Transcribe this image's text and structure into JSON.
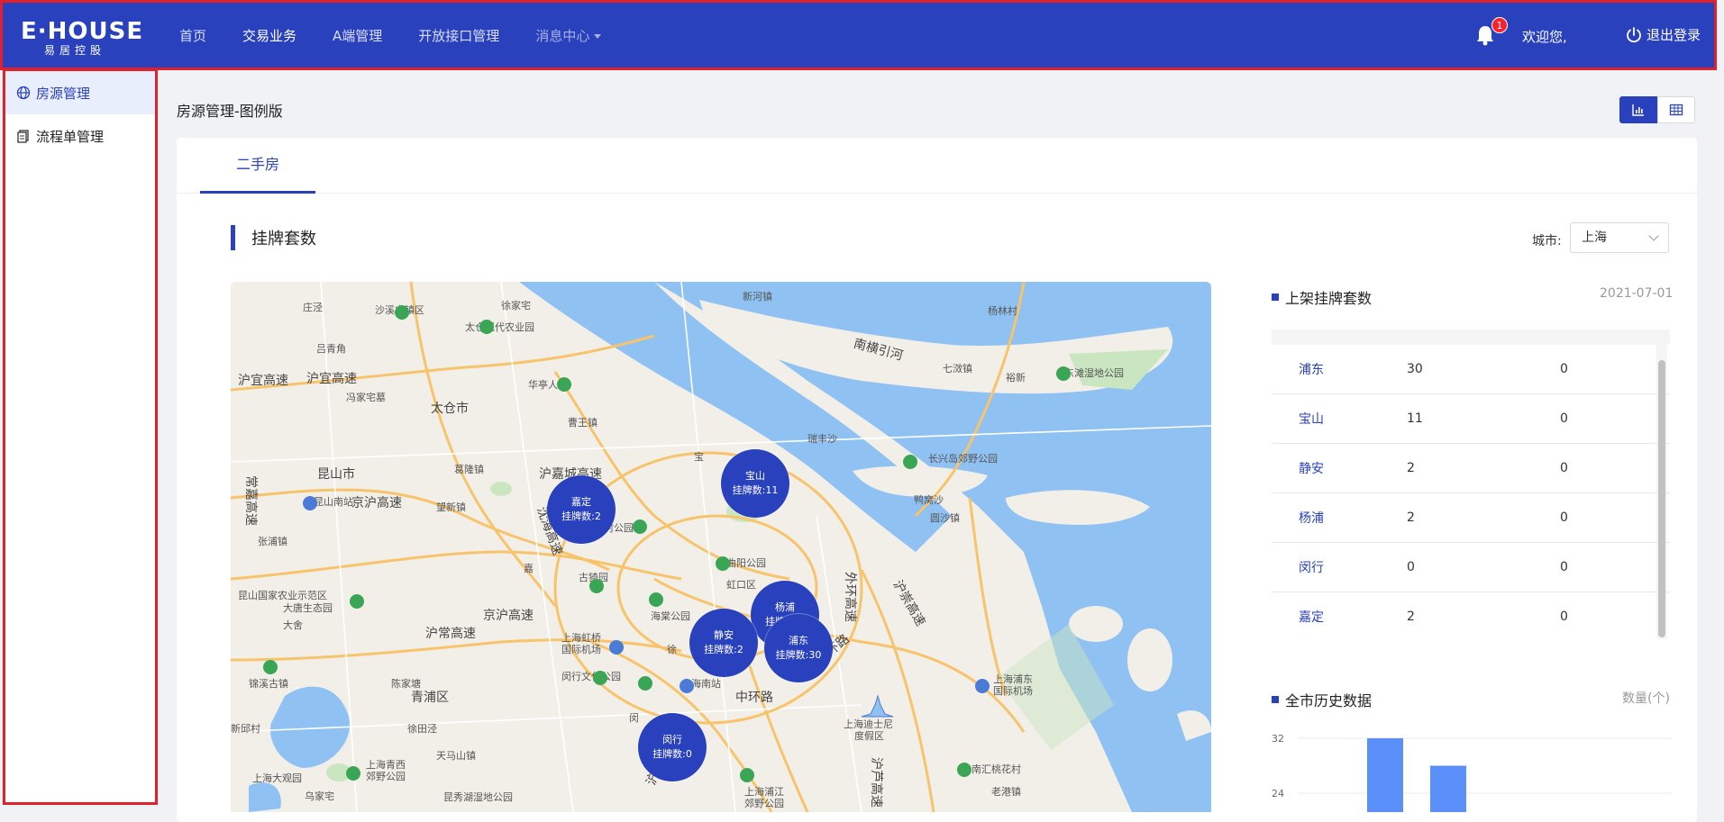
{
  "header": {
    "logo_main": "E·HOUSE",
    "logo_sub": "易居控股",
    "nav": [
      {
        "label": "首页"
      },
      {
        "label": "交易业务"
      },
      {
        "label": "A端管理"
      },
      {
        "label": "开放接口管理"
      },
      {
        "label": "消息中心"
      }
    ],
    "notification_count": "1",
    "welcome": "欢迎您,",
    "logout": "退出登录"
  },
  "sidebar": {
    "items": [
      {
        "label": "房源管理",
        "icon": "globe-icon"
      },
      {
        "label": "流程单管理",
        "icon": "document-icon"
      }
    ]
  },
  "main": {
    "page_title": "房源管理-图例版",
    "tabs": [
      {
        "label": "二手房"
      }
    ],
    "section_title": "挂牌套数",
    "city_label": "城市:",
    "city_value": "上海"
  },
  "map": {
    "clusters": [
      {
        "name": "嘉定",
        "count_label": "挂牌数:2"
      },
      {
        "name": "宝山",
        "count_label": "挂牌数:11"
      },
      {
        "name": "杨浦",
        "count_label": "挂牌数:2"
      },
      {
        "name": "静安",
        "count_label": "挂牌数:2"
      },
      {
        "name": "浦东",
        "count_label": "挂牌数:30"
      },
      {
        "name": "闵行",
        "count_label": "挂牌数:0"
      }
    ],
    "labels": [
      "庄泾",
      "沙溪古镇区",
      "徐家宅",
      "新河镇",
      "杨林村",
      "太仓现代农业园",
      "吕青角",
      "南横引河",
      "七滧镇",
      "东滩湿地公园",
      "裕新",
      "沪宜高速",
      "沪宜高速",
      "华亭人家",
      "冯家宅墓",
      "太仓市",
      "曹王镇",
      "瑞丰沙",
      "长兴岛郊野公园",
      "常嘉高速",
      "昆山市",
      "葛隆镇",
      "嘉",
      "沪嘉城高速",
      "宝",
      "鸭窝沙",
      "昆山南站",
      "望新镇",
      "顾村公园",
      "圆沙镇",
      "京沪高速",
      "沈海高速",
      "曲阳公园",
      "外环高速",
      "沪崇高速",
      "张浦镇",
      "古猗园",
      "虹口区",
      "昆山国家农业示范区",
      "大唐生态园",
      "京沪高速",
      "海棠公园",
      "大舍",
      "沪常高速",
      "上海虹桥国际机场",
      "徐",
      "中环路",
      "上海浦东国际机场",
      "锦溪古镇",
      "陈家塘",
      "青浦区",
      "闵行文化公园",
      "上海南站",
      "上海迪士尼度假区",
      "新邱村",
      "徐田泾",
      "天马山镇",
      "闵",
      "上海大观园",
      "上海青西郊野公园",
      "上海浦江郊野公园",
      "南汇桃花村",
      "老港镇",
      "乌家宅",
      "昆秀湖湿地公园",
      "沪芦高速",
      "沪",
      "外环路"
    ]
  },
  "right_panel": {
    "listing_title": "上架挂牌套数",
    "listing_date": "2021-07-01",
    "rows": [
      {
        "name": "浦东",
        "v1": "30",
        "v2": "0"
      },
      {
        "name": "宝山",
        "v1": "11",
        "v2": "0"
      },
      {
        "name": "静安",
        "v1": "2",
        "v2": "0"
      },
      {
        "name": "杨浦",
        "v1": "2",
        "v2": "0"
      },
      {
        "name": "闵行",
        "v1": "0",
        "v2": "0"
      },
      {
        "name": "嘉定",
        "v1": "2",
        "v2": "0"
      }
    ],
    "history_title": "全市历史数据",
    "history_unit": "数量(个)"
  },
  "chart_data": {
    "type": "bar",
    "title": "全市历史数据",
    "ylabel": "数量(个)",
    "yticks": [
      "32",
      "24"
    ],
    "ylim": [
      0,
      32
    ],
    "values": [
      32,
      28
    ],
    "color": "#5b8ff9"
  },
  "colors": {
    "primary": "#2a41bd",
    "highlight_border": "#e0202a",
    "water": "#8fc1f2",
    "park": "#c9e6c1"
  }
}
